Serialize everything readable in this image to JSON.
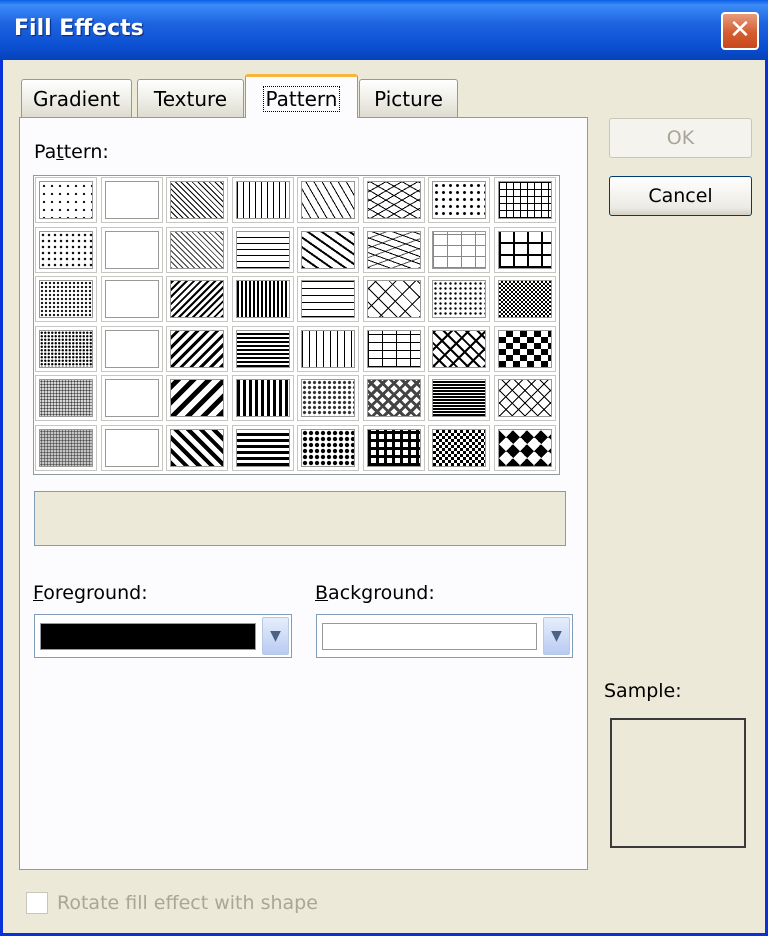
{
  "window": {
    "title": "Fill Effects",
    "close_icon": "close-icon"
  },
  "tabs": [
    {
      "label": "Gradient",
      "active": false
    },
    {
      "label": "Texture",
      "active": false
    },
    {
      "label": "Pattern",
      "active": true
    },
    {
      "label": "Picture",
      "active": false
    }
  ],
  "pattern_section": {
    "label_pre": "Pa",
    "label_access": "t",
    "label_post": "tern:",
    "patterns": [
      [
        "percent-5",
        "percent-50-gray",
        "dk-upward-diag-thin",
        "light-vertical",
        "wide-upward-diag",
        "zigzag",
        "confetti",
        "large-grid"
      ],
      [
        "percent-10",
        "percent-70",
        "light-upward-diag",
        "light-horizontal",
        "dashed-upward-diag",
        "wave",
        "dotted-grid",
        "small-grid"
      ],
      [
        "percent-20",
        "percent-75",
        "dark-downward-diag",
        "dark-vertical",
        "dashed-horizontal",
        "diagonal-brick",
        "small-confetti",
        "checker-small"
      ],
      [
        "percent-25",
        "percent-80",
        "wide-downward-diag",
        "dark-horizontal",
        "dashed-vertical",
        "horizontal-brick",
        "weave",
        "large-checker"
      ],
      [
        "percent-30",
        "percent-90",
        "wide-upward-diag-bold",
        "narrow-vertical",
        "sphere",
        "plaid",
        "shingle",
        "trellis"
      ],
      [
        "percent-40",
        "solid-90",
        "dark-upward-diag",
        "narrow-horizontal",
        "large-confetti",
        "diamond-grid",
        "divot",
        "solid-diamond"
      ]
    ],
    "selected": "none",
    "pattern_name": ""
  },
  "foreground": {
    "label_access": "F",
    "label_post": "oreground:",
    "color": "#000000"
  },
  "background": {
    "label_access": "B",
    "label_post": "ackground:",
    "color": "#ffffff"
  },
  "buttons": {
    "ok": "OK",
    "cancel": "Cancel"
  },
  "sample": {
    "label": "Sample:"
  },
  "rotate": {
    "label": "Rotate fill effect with shape",
    "checked": false,
    "enabled": false
  },
  "colors": {
    "dialog_bg": "#ece9d8",
    "title_blue": "#0a4ed0",
    "tab_highlight": "#f7b53b"
  }
}
